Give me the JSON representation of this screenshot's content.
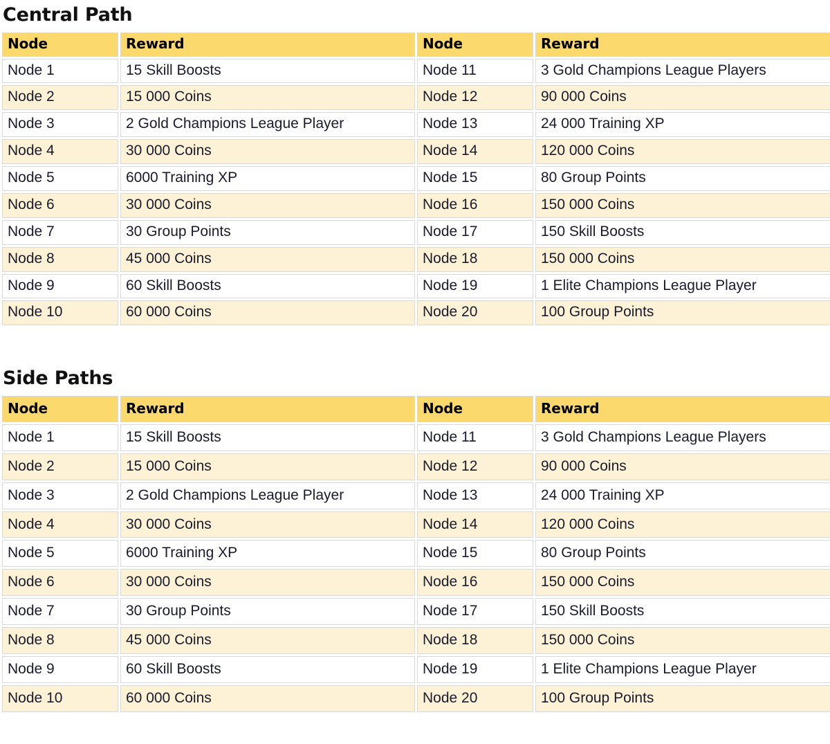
{
  "sections": [
    {
      "id": "central-path",
      "title": "Central Path",
      "columns": [
        "Node",
        "Reward",
        "Node",
        "Reward"
      ],
      "rows": [
        {
          "node_left": "Node 1",
          "reward_left": "15 Skill Boosts",
          "node_right": "Node 11",
          "reward_right": "3 Gold Champions League Players"
        },
        {
          "node_left": "Node 2",
          "reward_left": "15 000 Coins",
          "node_right": "Node 12",
          "reward_right": "90 000 Coins"
        },
        {
          "node_left": "Node 3",
          "reward_left": "2 Gold Champions League Player",
          "node_right": "Node 13",
          "reward_right": "24 000 Training XP"
        },
        {
          "node_left": "Node 4",
          "reward_left": "30 000 Coins",
          "node_right": "Node 14",
          "reward_right": "120 000 Coins"
        },
        {
          "node_left": "Node 5",
          "reward_left": "6000 Training XP",
          "node_right": "Node 15",
          "reward_right": "80 Group Points"
        },
        {
          "node_left": "Node 6",
          "reward_left": "30 000 Coins",
          "node_right": "Node 16",
          "reward_right": "150 000 Coins"
        },
        {
          "node_left": "Node 7",
          "reward_left": "30 Group Points",
          "node_right": "Node 17",
          "reward_right": "150 Skill Boosts"
        },
        {
          "node_left": "Node 8",
          "reward_left": "45 000 Coins",
          "node_right": "Node 18",
          "reward_right": "150 000 Coins"
        },
        {
          "node_left": "Node 9",
          "reward_left": "60 Skill Boosts",
          "node_right": "Node 19",
          "reward_right": "1 Elite Champions League Player"
        },
        {
          "node_left": "Node 10",
          "reward_left": "60 000 Coins",
          "node_right": "Node 20",
          "reward_right": "100 Group Points"
        }
      ]
    },
    {
      "id": "side-paths",
      "title": "Side Paths",
      "columns": [
        "Node",
        "Reward",
        "Node",
        "Reward"
      ],
      "rows": [
        {
          "node_left": "Node 1",
          "reward_left": "15 Skill Boosts",
          "node_right": "Node 11",
          "reward_right": "3 Gold Champions League Players"
        },
        {
          "node_left": "Node 2",
          "reward_left": "15 000 Coins",
          "node_right": "Node 12",
          "reward_right": "90 000 Coins"
        },
        {
          "node_left": "Node 3",
          "reward_left": "2 Gold Champions League Player",
          "node_right": "Node 13",
          "reward_right": "24 000 Training XP"
        },
        {
          "node_left": "Node 4",
          "reward_left": "30 000 Coins",
          "node_right": "Node 14",
          "reward_right": "120 000 Coins"
        },
        {
          "node_left": "Node 5",
          "reward_left": "6000 Training XP",
          "node_right": "Node 15",
          "reward_right": "80 Group Points"
        },
        {
          "node_left": "Node 6",
          "reward_left": "30 000 Coins",
          "node_right": "Node 16",
          "reward_right": "150 000 Coins"
        },
        {
          "node_left": "Node 7",
          "reward_left": "30 Group Points",
          "node_right": "Node 17",
          "reward_right": "150 Skill Boosts"
        },
        {
          "node_left": "Node 8",
          "reward_left": "45 000 Coins",
          "node_right": "Node 18",
          "reward_right": "150 000 Coins"
        },
        {
          "node_left": "Node 9",
          "reward_left": "60 Skill Boosts",
          "node_right": "Node 19",
          "reward_right": "1 Elite Champions League Player"
        },
        {
          "node_left": "Node 10",
          "reward_left": "60 000 Coins",
          "node_right": "Node 20",
          "reward_right": "100 Group Points"
        }
      ]
    }
  ],
  "colors": {
    "header_background": "#FBD96D",
    "row_background": "#FFFFFF",
    "row_alt_background": "#FDF2D5",
    "border": "#D8D8D8",
    "text": "#1A1A2E",
    "heading_text": "#111111"
  }
}
